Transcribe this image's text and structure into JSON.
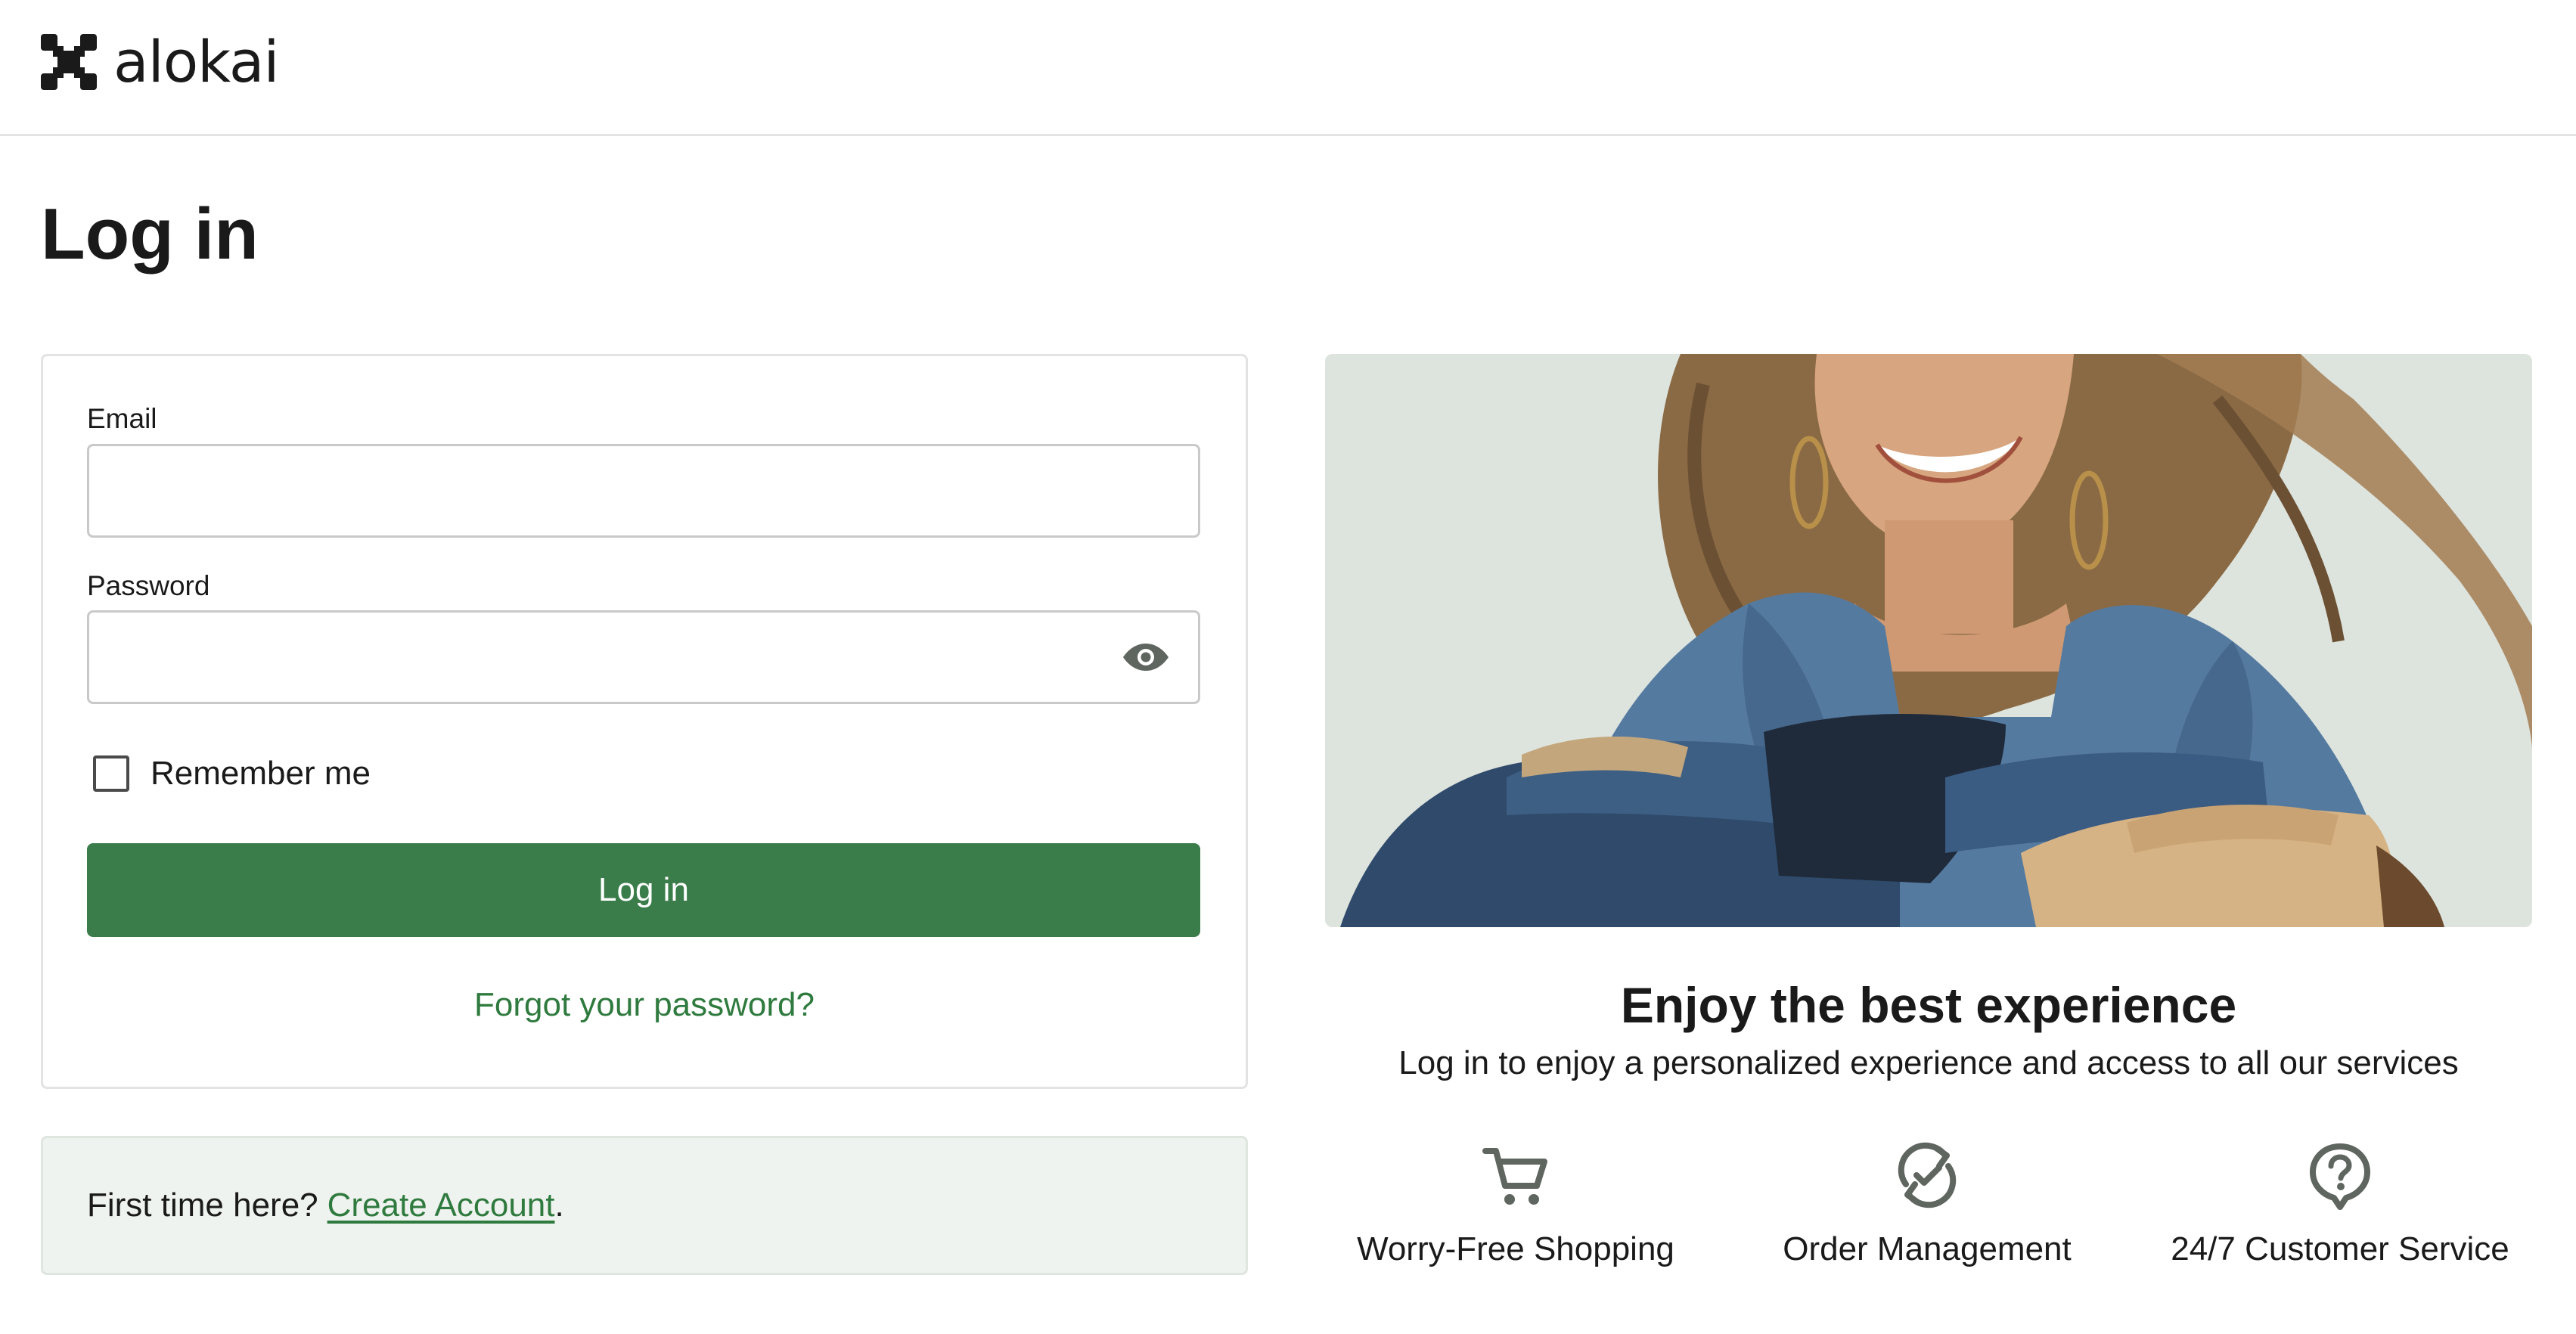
{
  "header": {
    "brand_name": "alokai",
    "logo_icon": "alokai-logo-icon"
  },
  "page": {
    "title": "Log in"
  },
  "login_form": {
    "email_label": "Email",
    "email_value": "",
    "password_label": "Password",
    "password_value": "",
    "password_toggle_icon": "eye-icon",
    "remember_label": "Remember me",
    "remember_checked": false,
    "submit_label": "Log in",
    "forgot_label": "Forgot your password?"
  },
  "signup": {
    "prompt": "First time here?",
    "link_label": "Create Account",
    "suffix": "."
  },
  "promo": {
    "title": "Enjoy the best experience",
    "subtitle": "Log in to enjoy a personalized experience and access to all our services",
    "features": [
      {
        "icon": "shopping-cart-icon",
        "label": "Worry-Free Shopping"
      },
      {
        "icon": "refresh-check-icon",
        "label": "Order Management"
      },
      {
        "icon": "help-circle-icon",
        "label": "24/7 Customer Service"
      }
    ]
  },
  "colors": {
    "primary": "#3b7d4a",
    "link": "#2f7a3e",
    "signup_bg": "#eff3ef",
    "hero_bg": "#dde3dd",
    "icon_gray": "#5f655f"
  }
}
